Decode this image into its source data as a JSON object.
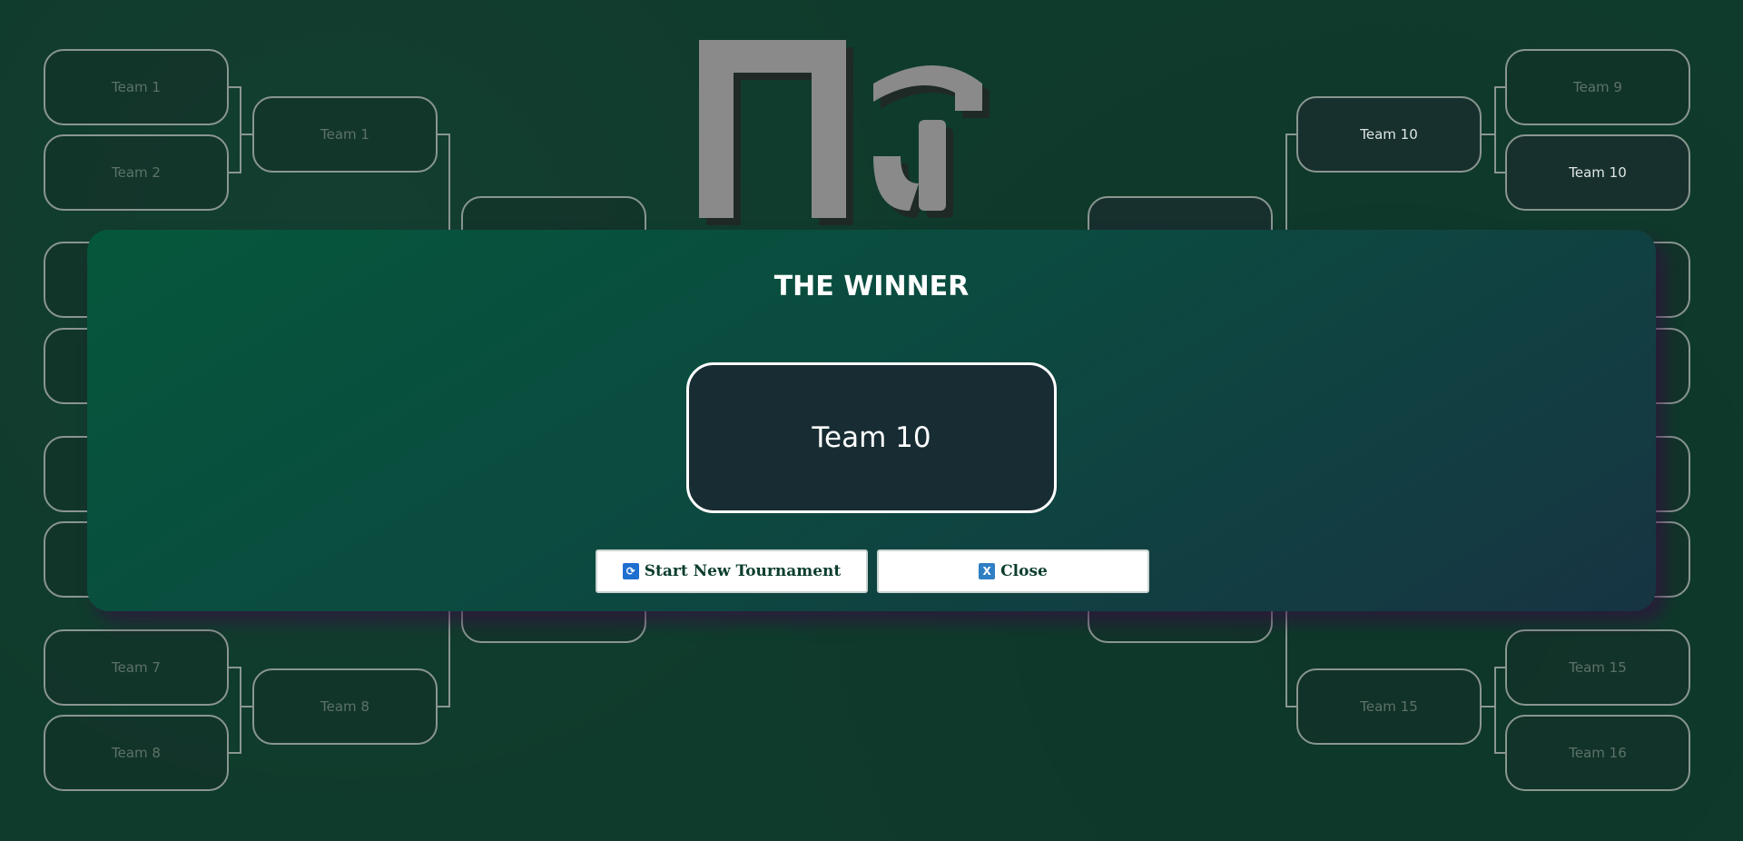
{
  "bracket": {
    "left": {
      "r1": [
        "Team 1",
        "Team 2",
        "Team 7",
        "Team 8"
      ],
      "r2": [
        "Team 1",
        "Team 8"
      ]
    },
    "right": {
      "r1": [
        "Team 9",
        "Team 10",
        "Team 15",
        "Team 16"
      ],
      "r2": [
        "Team 10",
        "Team 15"
      ]
    }
  },
  "modal": {
    "title": "THE WINNER",
    "winner": "Team 10",
    "buttons": {
      "new_tournament": "Start New Tournament",
      "close": "Close"
    }
  },
  "icons": {
    "new_tournament": "refresh-icon",
    "close": "close-x-icon"
  },
  "colors": {
    "accent": "#0b3d2e",
    "modal_start": "#05573b",
    "modal_end": "#173443"
  }
}
